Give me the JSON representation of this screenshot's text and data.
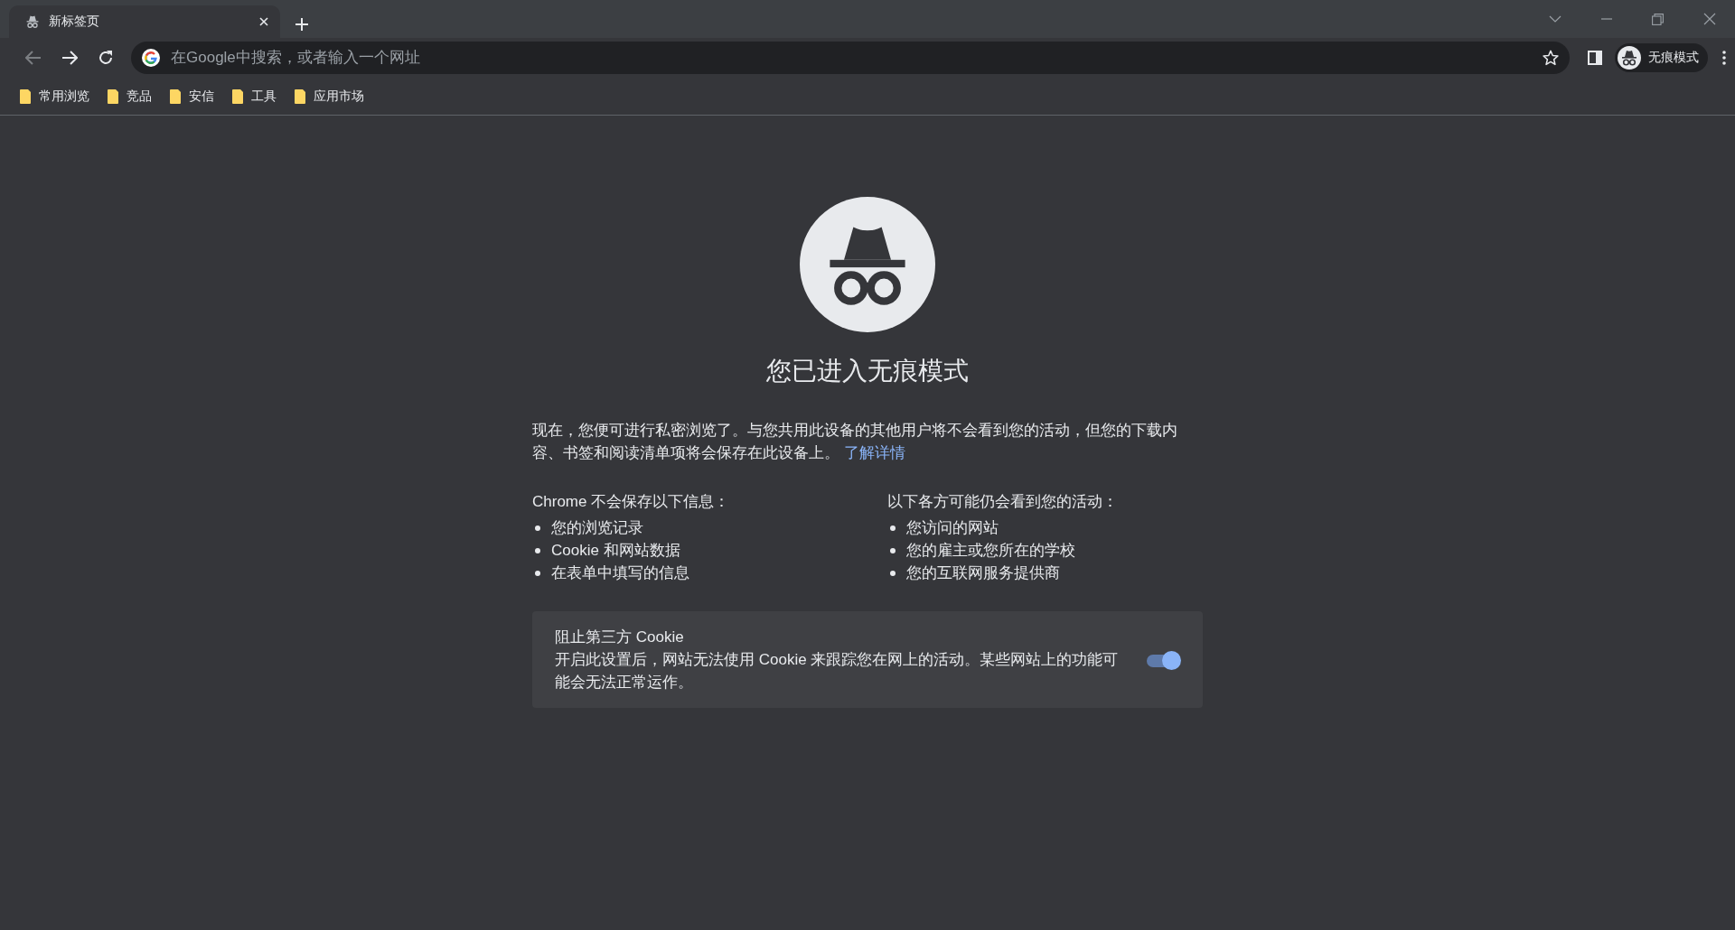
{
  "tabs": [
    {
      "title": "新标签页",
      "selected": true
    }
  ],
  "back_button": {
    "disabled": true
  },
  "address_bar": {
    "placeholder": "在Google中搜索，或者输入一个网址"
  },
  "profile": {
    "label": "无痕模式"
  },
  "bookmarks": [
    {
      "label": "常用浏览"
    },
    {
      "label": "竞品"
    },
    {
      "label": "安信"
    },
    {
      "label": "工具"
    },
    {
      "label": "应用市场"
    }
  ],
  "page": {
    "title": "您已进入无痕模式",
    "intro": "现在，您便可进行私密浏览了。与您共用此设备的其他用户将不会看到您的活动，但您的下载内容、书签和阅读清单项将会保存在此设备上。",
    "learn_more": "了解详情",
    "columns": [
      {
        "heading": "Chrome 不会保存以下信息：",
        "items": [
          "您的浏览记录",
          "Cookie 和网站数据",
          "在表单中填写的信息"
        ]
      },
      {
        "heading": "以下各方可能仍会看到您的活动：",
        "items": [
          "您访问的网站",
          "您的雇主或您所在的学校",
          "您的互联网服务提供商"
        ]
      }
    ],
    "cookie_card": {
      "title": "阻止第三方 Cookie",
      "description": "开启此设置后，网站无法使用 Cookie 来跟踪您在网上的活动。某些网站上的功能可能会无法正常运作。",
      "on": true
    }
  }
}
